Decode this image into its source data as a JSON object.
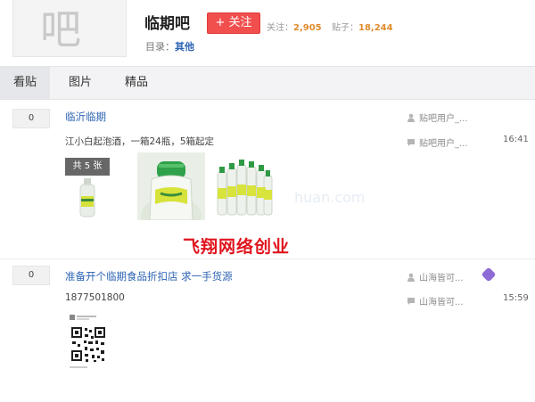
{
  "forum": {
    "avatar_glyph": "吧",
    "name": "临期吧",
    "follow_label": "+ 关注",
    "followers_label": "关注：",
    "followers_value": "2,905",
    "posts_label": "贴子：",
    "posts_value": "18,244",
    "directory_label": "目录：",
    "directory_value": "其他"
  },
  "tabs": [
    {
      "label": "看贴",
      "active": true
    },
    {
      "label": "图片",
      "active": false
    },
    {
      "label": "精品",
      "active": false
    }
  ],
  "threads": [
    {
      "reply_count": "0",
      "title": "临沂临期",
      "abstract": "江小白起泡酒，一箱24瓶，5箱起定",
      "image_count": "共 5 张",
      "author": "贴吧用户_...",
      "last_reply_user": "贴吧用户_...",
      "time": "16:41"
    },
    {
      "reply_count": "0",
      "title": "准备开个临期食品折扣店 求一手货源",
      "abstract": "1877501800",
      "author": "山海皆可...",
      "last_reply_user": "山海皆可...",
      "time": "15:59"
    }
  ],
  "overlay": {
    "watermark": "飞翔网络创业",
    "faint_watermark": "huan.com"
  },
  "colors": {
    "link_blue": "#2d64b3",
    "follow_red": "#f14e4e",
    "stat_orange": "#e08b2e",
    "watermark_red": "#e0141e"
  },
  "icons": [
    "user-icon",
    "reply-icon",
    "level-badge-icon"
  ]
}
